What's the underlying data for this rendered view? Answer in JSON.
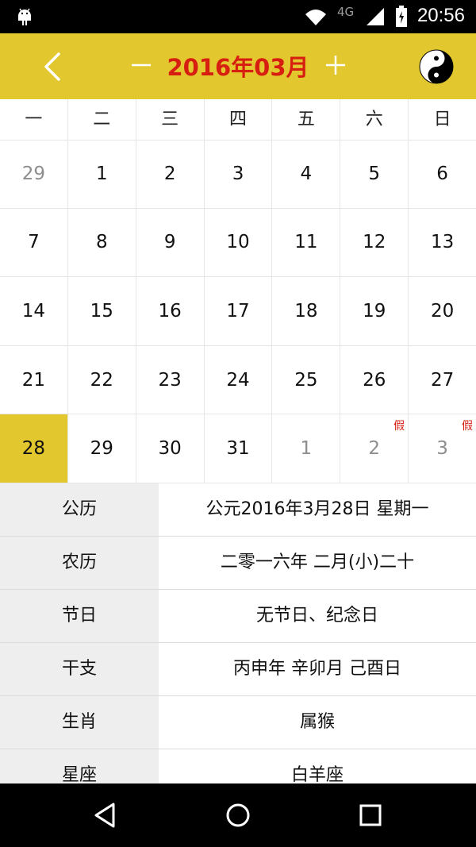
{
  "status_bar": {
    "time": "20:56",
    "network": "4G",
    "icons": [
      "android-icon",
      "wifi-icon",
      "signal-icon",
      "battery-icon"
    ]
  },
  "header": {
    "title": "2016年03月",
    "back_icon": "chevron-left-icon",
    "prev_icon": "minus-icon",
    "next_icon": "plus-icon",
    "mode_icon": "yin-yang-icon",
    "accent_color": "#e3c72e",
    "title_color": "#d61f10"
  },
  "weekdays": [
    "一",
    "二",
    "三",
    "四",
    "五",
    "六",
    "日"
  ],
  "calendar": {
    "rows": [
      [
        {
          "d": "29",
          "m": true
        },
        {
          "d": "1"
        },
        {
          "d": "2"
        },
        {
          "d": "3"
        },
        {
          "d": "4"
        },
        {
          "d": "5"
        },
        {
          "d": "6"
        }
      ],
      [
        {
          "d": "7"
        },
        {
          "d": "8"
        },
        {
          "d": "9"
        },
        {
          "d": "10"
        },
        {
          "d": "11"
        },
        {
          "d": "12"
        },
        {
          "d": "13"
        }
      ],
      [
        {
          "d": "14"
        },
        {
          "d": "15"
        },
        {
          "d": "16"
        },
        {
          "d": "17"
        },
        {
          "d": "18"
        },
        {
          "d": "19"
        },
        {
          "d": "20"
        }
      ],
      [
        {
          "d": "21"
        },
        {
          "d": "22"
        },
        {
          "d": "23"
        },
        {
          "d": "24"
        },
        {
          "d": "25"
        },
        {
          "d": "26"
        },
        {
          "d": "27"
        }
      ],
      [
        {
          "d": "28",
          "sel": true
        },
        {
          "d": "29"
        },
        {
          "d": "30"
        },
        {
          "d": "31"
        },
        {
          "d": "1",
          "m": true
        },
        {
          "d": "2",
          "m": true,
          "tag": "假"
        },
        {
          "d": "3",
          "m": true,
          "tag": "假"
        }
      ]
    ]
  },
  "info": [
    {
      "key": "公历",
      "value": "公元2016年3月28日 星期一"
    },
    {
      "key": "农历",
      "value": "二零一六年 二月(小)二十"
    },
    {
      "key": "节日",
      "value": "无节日、纪念日"
    },
    {
      "key": "干支",
      "value": "丙申年 辛卯月 己酉日"
    },
    {
      "key": "生肖",
      "value": "属猴"
    },
    {
      "key": "星座",
      "value": "白羊座"
    }
  ],
  "nav_bar": {
    "buttons": [
      "back-icon",
      "home-icon",
      "recents-icon"
    ]
  }
}
